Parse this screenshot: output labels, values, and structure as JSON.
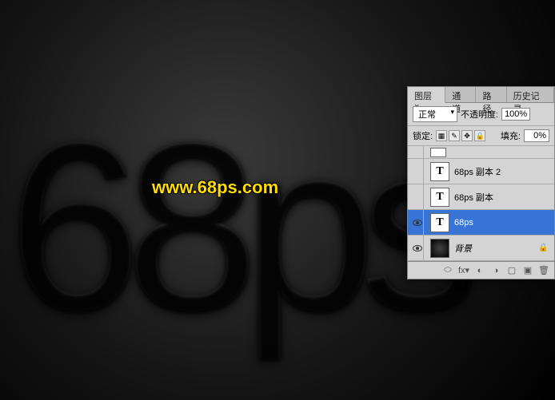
{
  "canvas_text": "68ps",
  "watermark": "www.68ps.com",
  "panel": {
    "tabs": [
      {
        "label": "图层",
        "active": true
      },
      {
        "label": "通道",
        "active": false
      },
      {
        "label": "路径",
        "active": false
      },
      {
        "label": "历史记录",
        "active": false
      }
    ],
    "blend_mode": "正常",
    "opacity_label": "不透明度:",
    "opacity_value": "100%",
    "lock_label": "锁定:",
    "fill_label": "填充:",
    "fill_value": "0%",
    "layers": [
      {
        "name": "68ps 副本 2",
        "type": "T",
        "visible": false,
        "selected": false
      },
      {
        "name": "68ps 副本",
        "type": "T",
        "visible": false,
        "selected": false
      },
      {
        "name": "68ps",
        "type": "T",
        "visible": true,
        "selected": true
      },
      {
        "name": "背景",
        "type": "bg",
        "visible": true,
        "selected": false,
        "locked": true
      }
    ]
  }
}
